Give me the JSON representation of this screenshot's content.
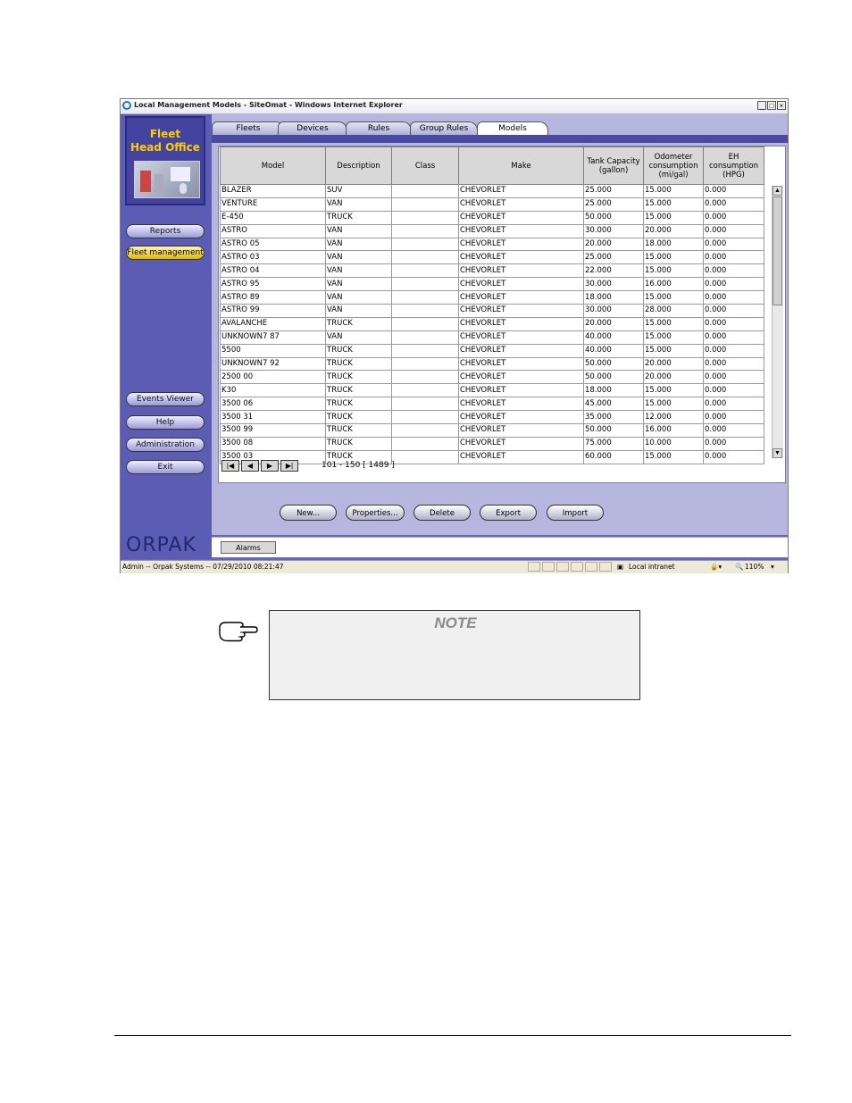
{
  "window": {
    "title": "Local Management Models - SiteOmat - Windows Internet Explorer",
    "controls": {
      "minimize": "_",
      "maximize": "□",
      "close": "×"
    }
  },
  "sidebar": {
    "logo_line1": "Fleet",
    "logo_line2": "Head Office",
    "items": [
      {
        "label": "Reports"
      },
      {
        "label": "Fleet management"
      },
      {
        "label": "Events Viewer"
      },
      {
        "label": "Help"
      },
      {
        "label": "Administration"
      },
      {
        "label": "Exit"
      }
    ],
    "brand": "ORPAK"
  },
  "tabs": [
    "Fleets",
    "Devices",
    "Rules",
    "Group Rules",
    "Models"
  ],
  "grid": {
    "columns": [
      "Model",
      "Description",
      "Class",
      "Make",
      "Tank Capacity (gallon)",
      "Odometer consumption (mi/gal)",
      "EH consumption (HPG)"
    ],
    "rows": [
      [
        "BLAZER",
        "SUV",
        "",
        "CHEVORLET",
        "25.000",
        "15.000",
        "0.000"
      ],
      [
        "VENTURE",
        "VAN",
        "",
        "CHEVORLET",
        "25.000",
        "15.000",
        "0.000"
      ],
      [
        "E-450",
        "TRUCK",
        "",
        "CHEVORLET",
        "50.000",
        "15.000",
        "0.000"
      ],
      [
        "ASTRO",
        "VAN",
        "",
        "CHEVORLET",
        "30.000",
        "20.000",
        "0.000"
      ],
      [
        "ASTRO 05",
        "VAN",
        "",
        "CHEVORLET",
        "20.000",
        "18.000",
        "0.000"
      ],
      [
        "ASTRO 03",
        "VAN",
        "",
        "CHEVORLET",
        "25.000",
        "15.000",
        "0.000"
      ],
      [
        "ASTRO 04",
        "VAN",
        "",
        "CHEVORLET",
        "22.000",
        "15.000",
        "0.000"
      ],
      [
        "ASTRO 95",
        "VAN",
        "",
        "CHEVORLET",
        "30.000",
        "16.000",
        "0.000"
      ],
      [
        "ASTRO 89",
        "VAN",
        "",
        "CHEVORLET",
        "18.000",
        "15.000",
        "0.000"
      ],
      [
        "ASTRO 99",
        "VAN",
        "",
        "CHEVORLET",
        "30.000",
        "28.000",
        "0.000"
      ],
      [
        "AVALANCHE",
        "TRUCK",
        "",
        "CHEVORLET",
        "20.000",
        "15.000",
        "0.000"
      ],
      [
        "UNKNOWN7 87",
        "VAN",
        "",
        "CHEVORLET",
        "40.000",
        "15.000",
        "0.000"
      ],
      [
        "5500",
        "TRUCK",
        "",
        "CHEVORLET",
        "40.000",
        "15.000",
        "0.000"
      ],
      [
        "UNKNOWN7 92",
        "TRUCK",
        "",
        "CHEVORLET",
        "50.000",
        "20.000",
        "0.000"
      ],
      [
        "2500 00",
        "TRUCK",
        "",
        "CHEVORLET",
        "50.000",
        "20.000",
        "0.000"
      ],
      [
        "K30",
        "TRUCK",
        "",
        "CHEVORLET",
        "18.000",
        "15.000",
        "0.000"
      ],
      [
        "3500 06",
        "TRUCK",
        "",
        "CHEVORLET",
        "45.000",
        "15.000",
        "0.000"
      ],
      [
        "3500 31",
        "TRUCK",
        "",
        "CHEVORLET",
        "35.000",
        "12.000",
        "0.000"
      ],
      [
        "3500 99",
        "TRUCK",
        "",
        "CHEVORLET",
        "50.000",
        "16.000",
        "0.000"
      ],
      [
        "3500 08",
        "TRUCK",
        "",
        "CHEVORLET",
        "75.000",
        "10.000",
        "0.000"
      ],
      [
        "3500 03",
        "TRUCK",
        "",
        "CHEVORLET",
        "60.000",
        "15.000",
        "0.000"
      ]
    ],
    "pager": {
      "first": "|◀",
      "prev": "◀",
      "next": "▶",
      "last": "▶|",
      "info": "101 - 150  [ 1489 ]"
    }
  },
  "actions": [
    "New...",
    "Properties...",
    "Delete",
    "Export",
    "Import"
  ],
  "alarms_label": "Alarms",
  "statusbar": {
    "text": "Admin -- Orpak Systems -- 07/29/2010  08:21:47",
    "zone": "Local intranet",
    "zoom": "110%"
  },
  "note": {
    "title": "NOTE"
  }
}
